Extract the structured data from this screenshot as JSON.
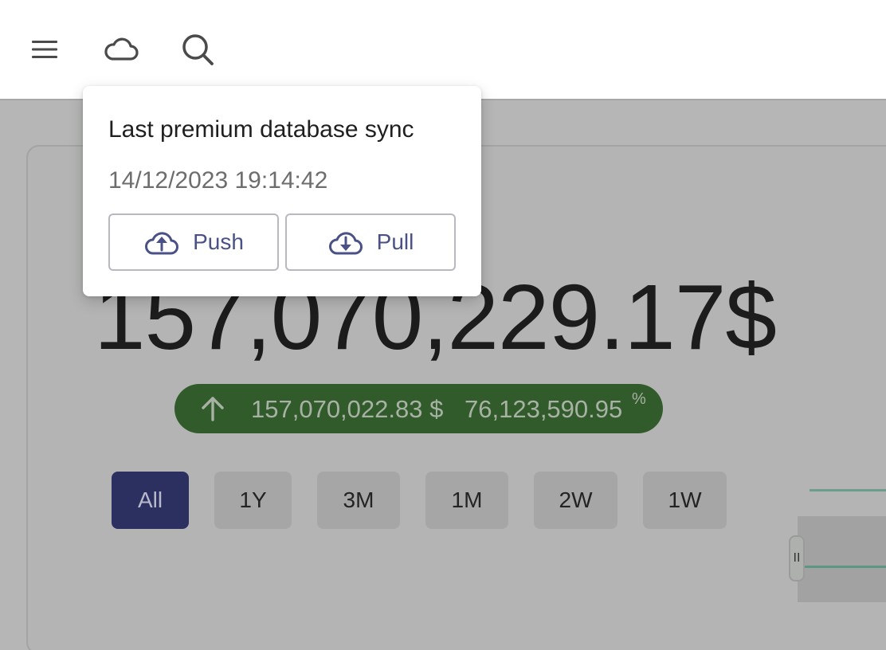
{
  "appbar": {
    "icons": [
      "menu-icon",
      "cloud-icon",
      "search-icon"
    ]
  },
  "portfolio": {
    "total_value": "157,070,229.17$",
    "change": {
      "direction": "up",
      "amount": "157,070,022.83 $",
      "percent": "76,123,590.95",
      "percent_sign": "%"
    },
    "ranges": [
      {
        "label": "All",
        "active": true
      },
      {
        "label": "1Y",
        "active": false
      },
      {
        "label": "3M",
        "active": false
      },
      {
        "label": "1M",
        "active": false
      },
      {
        "label": "2W",
        "active": false
      },
      {
        "label": "1W",
        "active": false
      }
    ],
    "chart_handle_label": "II"
  },
  "popover": {
    "title": "Last premium database sync",
    "timestamp": "14/12/2023 19:14:42",
    "push_label": "Push",
    "pull_label": "Pull"
  },
  "colors": {
    "accent": "#2b3061",
    "positive": "#325b2c",
    "button_text": "#4a5187"
  }
}
